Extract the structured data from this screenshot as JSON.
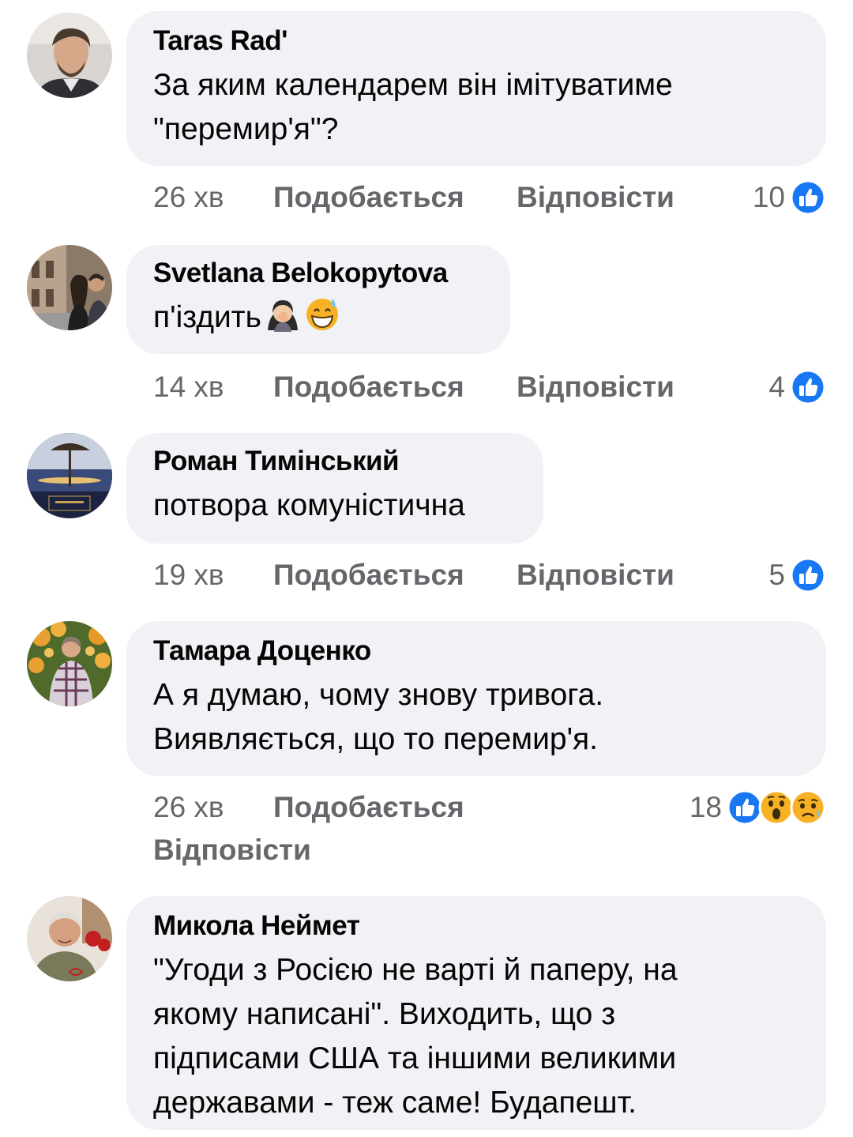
{
  "ui": {
    "like_label": "Подобається",
    "reply_label": "Відповісти"
  },
  "comments": [
    {
      "author": "Taras Rad'",
      "lines": [
        "За яким календарем він імітуватиме",
        "\"перемир'я\"?"
      ],
      "time": "26 хв",
      "reaction_count": "10",
      "reactions": [
        "like-icon"
      ]
    },
    {
      "author": "Svetlana Belokopytova",
      "lines": [
        "п'іздить"
      ],
      "emoji": [
        "woman-facepalming-emoji",
        "grinning-sweat-emoji"
      ],
      "time": "14 хв",
      "reaction_count": "4",
      "reactions": [
        "like-icon"
      ]
    },
    {
      "author": "Роман Тимінський",
      "lines": [
        "потвора комуністична"
      ],
      "time": "19 хв",
      "reaction_count": "5",
      "reactions": [
        "like-icon"
      ]
    },
    {
      "author": "Тамара Доценко",
      "lines": [
        "А я думаю, чому знову тривога.",
        "Виявляється, що то перемир'я."
      ],
      "time": "26 хв",
      "reaction_count": "18",
      "reactions": [
        "like-icon",
        "wow-icon",
        "sad-icon"
      ]
    },
    {
      "author": "Микола Неймет",
      "lines": [
        "\"Угоди з Росією не варті й паперу, на",
        "якому написані\". Виходить, що з",
        "підписами США та іншими великими",
        "державами - теж саме! Будапешт."
      ]
    }
  ],
  "colors": {
    "bubble": "#f0f2f5",
    "meta_text": "#65676b",
    "like_blue": "#1877f2",
    "emoji_yellow": "#f7b125"
  }
}
